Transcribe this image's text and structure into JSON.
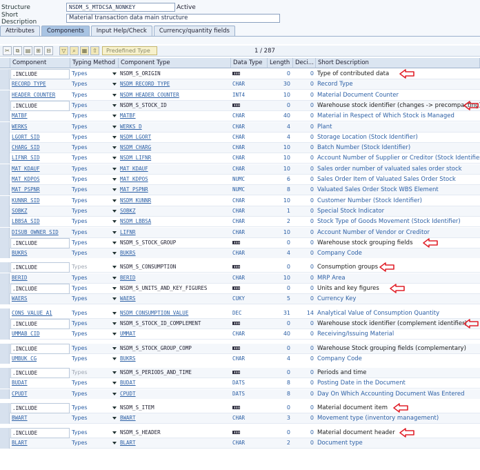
{
  "header": {
    "structure_label": "Structure",
    "structure_value": "NSDM_S_MTDCSA_NONKEY",
    "status": "Active",
    "short_desc_label": "Short Description",
    "short_desc_value": "Material transaction data main structure"
  },
  "tabs": [
    {
      "label": "Attributes",
      "active": false
    },
    {
      "label": "Components",
      "active": true
    },
    {
      "label": "Input Help/Check",
      "active": false
    },
    {
      "label": "Currency/quantity fields",
      "active": false
    }
  ],
  "toolbar": {
    "predefined_type_label": "Predefined Type",
    "pager": "1 / 287"
  },
  "columns": {
    "component": "Component",
    "typing_method": "Typing Method",
    "component_type": "Component Type",
    "data_type": "Data Type",
    "length": "Length",
    "decimals": "Deci...",
    "short_description": "Short Description"
  },
  "rows": [
    {
      "comp": ".INCLUDE",
      "typing": "Types",
      "ctype": "NSDM_S_ORIGIN",
      "dtype": "",
      "len": "0",
      "dec": "0",
      "desc": "Type of contributed data",
      "include": true,
      "arrow": true
    },
    {
      "comp": "RECORD_TYPE",
      "typing": "Types",
      "ctype": "NSDM_RECORD_TYPE",
      "dtype": "CHAR",
      "len": "30",
      "dec": "0",
      "desc": "Record Type"
    },
    {
      "comp": "HEADER_COUNTER",
      "typing": "Types",
      "ctype": "NSDM_HEADER_COUNTER",
      "dtype": "INT4",
      "len": "10",
      "dec": "0",
      "desc": "Material Document Counter"
    },
    {
      "comp": ".INCLUDE",
      "typing": "Types",
      "ctype": "NSDM_S_STOCK_ID",
      "dtype": "",
      "len": "0",
      "dec": "0",
      "desc": "Warehouse stock identifier (changes -> precompacting)",
      "include": true,
      "arrow": true
    },
    {
      "comp": "MATBF",
      "typing": "Types",
      "ctype": "MATBF",
      "dtype": "CHAR",
      "len": "40",
      "dec": "0",
      "desc": "Material in Respect of Which Stock is Managed"
    },
    {
      "comp": "WERKS",
      "typing": "Types",
      "ctype": "WERKS_D",
      "dtype": "CHAR",
      "len": "4",
      "dec": "0",
      "desc": "Plant"
    },
    {
      "comp": "LGORT_SID",
      "typing": "Types",
      "ctype": "NSDM_LGORT",
      "dtype": "CHAR",
      "len": "4",
      "dec": "0",
      "desc": "Storage Location (Stock Identifier)"
    },
    {
      "comp": "CHARG_SID",
      "typing": "Types",
      "ctype": "NSDM_CHARG",
      "dtype": "CHAR",
      "len": "10",
      "dec": "0",
      "desc": "Batch Number (Stock Identifier)"
    },
    {
      "comp": "LIFNR_SID",
      "typing": "Types",
      "ctype": "NSDM_LIFNR",
      "dtype": "CHAR",
      "len": "10",
      "dec": "0",
      "desc": "Account Number of Supplier or Creditor (Stock Identifier)"
    },
    {
      "comp": "MAT_KDAUF",
      "typing": "Types",
      "ctype": "MAT_KDAUF",
      "dtype": "CHAR",
      "len": "10",
      "dec": "0",
      "desc": "Sales order number of valuated sales order stock"
    },
    {
      "comp": "MAT_KDPOS",
      "typing": "Types",
      "ctype": "MAT_KDPOS",
      "dtype": "NUMC",
      "len": "6",
      "dec": "0",
      "desc": "Sales Order Item of Valuated Sales Order Stock"
    },
    {
      "comp": "MAT_PSPNR",
      "typing": "Types",
      "ctype": "MAT_PSPNR",
      "dtype": "NUMC",
      "len": "8",
      "dec": "0",
      "desc": "Valuated Sales Order Stock WBS Element"
    },
    {
      "comp": "KUNNR_SID",
      "typing": "Types",
      "ctype": "NSDM_KUNNR",
      "dtype": "CHAR",
      "len": "10",
      "dec": "0",
      "desc": "Customer Number (Stock Identifier)"
    },
    {
      "comp": "SOBKZ",
      "typing": "Types",
      "ctype": "SOBKZ",
      "dtype": "CHAR",
      "len": "1",
      "dec": "0",
      "desc": "Special Stock Indicator"
    },
    {
      "comp": "LBBSA_SID",
      "typing": "Types",
      "ctype": "NSDM_LBBSA",
      "dtype": "CHAR",
      "len": "2",
      "dec": "0",
      "desc": "Stock Type of Goods Movement (Stock Identifier)"
    },
    {
      "comp": "DISUB_OWNER_SID",
      "typing": "Types",
      "ctype": "LIFNR",
      "dtype": "CHAR",
      "len": "10",
      "dec": "0",
      "desc": "Account Number of Vendor or Creditor"
    },
    {
      "comp": ".INCLUDE",
      "typing": "Types",
      "ctype": "NSDM_S_STOCK_GROUP",
      "dtype": "",
      "len": "0",
      "dec": "0",
      "desc": "Warehouse stock grouping fields",
      "include": true,
      "arrow": true
    },
    {
      "comp": "BUKRS",
      "typing": "Types",
      "ctype": "BUKRS",
      "dtype": "CHAR",
      "len": "4",
      "dec": "0",
      "desc": "Company Code",
      "gap_after": true
    },
    {
      "comp": ".INCLUDE",
      "typing": "Types",
      "ctype": "NSDM_S_CONSUMPTION",
      "dtype": "",
      "len": "0",
      "dec": "0",
      "desc": "Consumption groups",
      "include": true,
      "arrow": true,
      "gray_typing": true
    },
    {
      "comp": "BERID",
      "typing": "Types",
      "ctype": "BERID",
      "dtype": "CHAR",
      "len": "10",
      "dec": "0",
      "desc": "MRP Area"
    },
    {
      "comp": ".INCLUDE",
      "typing": "Types",
      "ctype": "NSDM_S_UNITS_AND_KEY_FIGURES",
      "dtype": "",
      "len": "0",
      "dec": "0",
      "desc": "Units and key figures",
      "include": true,
      "arrow": true
    },
    {
      "comp": "WAERS",
      "typing": "Types",
      "ctype": "WAERS",
      "dtype": "CUKY",
      "len": "5",
      "dec": "0",
      "desc": "Currency Key",
      "gap_after": true
    },
    {
      "comp": "CONS_VALUE_A1",
      "typing": "Types",
      "ctype": "NSDM_CONSUMPTION_VALUE",
      "dtype": "DEC",
      "len": "31",
      "dec": "14",
      "desc": "Analytical Value of Consumption Quantity"
    },
    {
      "comp": ".INCLUDE",
      "typing": "Types",
      "ctype": "NSDM_S_STOCK_ID_COMPLEMENT",
      "dtype": "",
      "len": "0",
      "dec": "0",
      "desc": "Warehouse stock identifier (complement identifier)",
      "include": true,
      "arrow": true
    },
    {
      "comp": "UMMAB_CID",
      "typing": "Types",
      "ctype": "UMMAT",
      "dtype": "CHAR",
      "len": "40",
      "dec": "0",
      "desc": "Receiving/Issuing Material",
      "gap_after": true
    },
    {
      "comp": ".INCLUDE",
      "typing": "Types",
      "ctype": "NSDM_S_STOCK_GROUP_COMP",
      "dtype": "",
      "len": "0",
      "dec": "0",
      "desc": "Warehouse Stock grouping fields (complementary)",
      "include": true
    },
    {
      "comp": "UMBUK_CG",
      "typing": "Types",
      "ctype": "BUKRS",
      "dtype": "CHAR",
      "len": "4",
      "dec": "0",
      "desc": "Company Code",
      "gap_after": true
    },
    {
      "comp": ".INCLUDE",
      "typing": "Types",
      "ctype": "NSDM_S_PERIODS_AND_TIME",
      "dtype": "",
      "len": "0",
      "dec": "0",
      "desc": "Periods and time",
      "include": true,
      "gray_typing": true
    },
    {
      "comp": "BUDAT",
      "typing": "Types",
      "ctype": "BUDAT",
      "dtype": "DATS",
      "len": "8",
      "dec": "0",
      "desc": "Posting Date in the Document"
    },
    {
      "comp": "CPUDT",
      "typing": "Types",
      "ctype": "CPUDT",
      "dtype": "DATS",
      "len": "8",
      "dec": "0",
      "desc": "Day On Which Accounting Document Was Entered",
      "gap_after": true
    },
    {
      "comp": ".INCLUDE",
      "typing": "Types",
      "ctype": "NSDM_S_ITEM",
      "dtype": "",
      "len": "0",
      "dec": "0",
      "desc": "Material document item",
      "include": true,
      "arrow": true
    },
    {
      "comp": "BWART",
      "typing": "Types",
      "ctype": "BWART",
      "dtype": "CHAR",
      "len": "3",
      "dec": "0",
      "desc": "Movement type (inventory management)",
      "gap_after": true
    },
    {
      "comp": ".INCLUDE",
      "typing": "Types",
      "ctype": "NSDM_S_HEADER",
      "dtype": "",
      "len": "0",
      "dec": "0",
      "desc": "Material document header",
      "include": true,
      "arrow": true
    },
    {
      "comp": "BLART",
      "typing": "Types",
      "ctype": "BLART",
      "dtype": "CHAR",
      "len": "2",
      "dec": "0",
      "desc": "Document type"
    }
  ],
  "colors": {
    "accent_link": "#2b5fa5",
    "arrow_red": "#e0202a",
    "header_bg": "#dbe5f1"
  }
}
